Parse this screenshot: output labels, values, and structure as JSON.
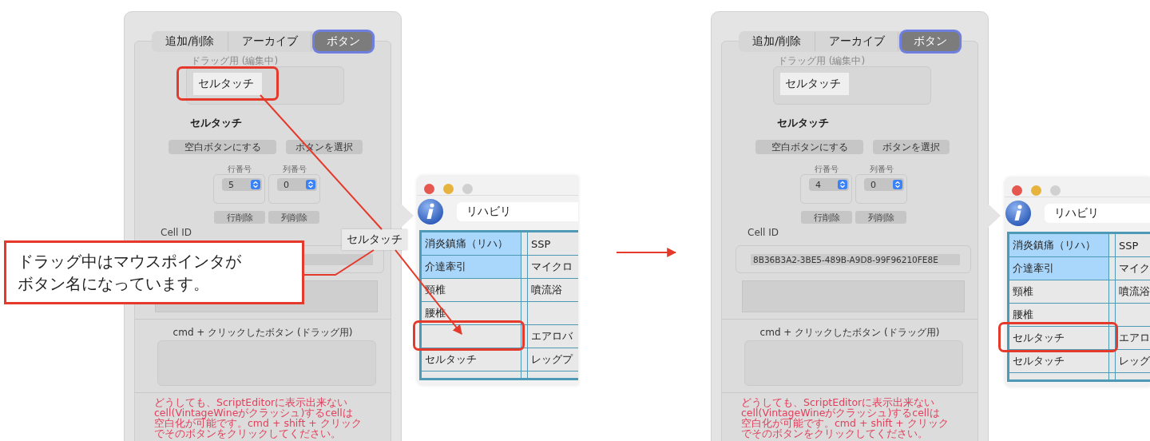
{
  "steps": [
    {
      "panel": {
        "tabs": [
          {
            "label": "追加/削除",
            "selected": false
          },
          {
            "label": "アーカイブ",
            "selected": false
          },
          {
            "label": "ボタン",
            "selected": true
          }
        ],
        "drag_label": "ドラッグ用 (編集中)",
        "drag_chip": {
          "label": "セルタッチ",
          "highlighted": true
        },
        "button_name": "セルタッチ",
        "action_buttons": [
          "空白ボタンにする",
          "ボタンを選択"
        ],
        "row_number": {
          "label": "行番号",
          "value": "5"
        },
        "column_number": {
          "label": "列番号",
          "value": "0"
        },
        "delete_buttons": [
          "行削除",
          "列削除"
        ],
        "cell_id_label": "Cell ID",
        "cmd_click_label": "cmd + クリックしたボタン (ドラッグ用)",
        "note": [
          "どうしても、ScriptEditorに表示出来ない",
          "cell(VintageWineがクラッシュ)するcellは",
          "空白化が可能です。cmd + shift + クリック",
          "でそのボタンをクリックしてください。"
        ]
      },
      "window": {
        "search_value": "リハビリ",
        "rows": [
          {
            "column_1": "消炎鎮痛（リハ）",
            "column_2": "SSP",
            "selected": true,
            "highlighted": false
          },
          {
            "column_1": "介達牽引",
            "column_2": "マイクロ",
            "selected": true,
            "highlighted": false
          },
          {
            "column_1": "頸椎",
            "column_2": "噴流浴",
            "selected": false,
            "highlighted": false
          },
          {
            "column_1": "腰椎",
            "selected": false,
            "highlighted": false
          },
          {
            "column_2": "エアロバ",
            "selected": false,
            "highlighted": true
          },
          {
            "column_1": "セルタッチ",
            "column_2": "レッグプ",
            "selected": false,
            "highlighted": false
          }
        ]
      },
      "drag_tooltip": "セルタッチ",
      "callout": [
        "ドラッグ中はマウスポインタが",
        "ボタン名になっています。"
      ]
    },
    {
      "panel": {
        "tabs": [
          {
            "label": "追加/削除",
            "selected": false
          },
          {
            "label": "アーカイブ",
            "selected": false
          },
          {
            "label": "ボタン",
            "selected": true
          }
        ],
        "drag_label": "ドラッグ用 (編集中)",
        "drag_chip": {
          "label": "セルタッチ",
          "highlighted": false
        },
        "button_name": "セルタッチ",
        "action_buttons": [
          "空白ボタンにする",
          "ボタンを選択"
        ],
        "row_number": {
          "label": "行番号",
          "value": "4"
        },
        "column_number": {
          "label": "列番号",
          "value": "0"
        },
        "delete_buttons": [
          "行削除",
          "列削除"
        ],
        "cell_id_label": "Cell ID",
        "cell_id": "8B36B3A2-3BE5-489B-A9D8-99F96210FE8E",
        "cmd_click_label": "cmd + クリックしたボタン (ドラッグ用)",
        "note": [
          "どうしても、ScriptEditorに表示出来ない",
          "cell(VintageWineがクラッシュ)するcellは",
          "空白化が可能です。cmd + shift + クリック",
          "でそのボタンをクリックしてください。"
        ]
      },
      "window": {
        "search_value": "リハビリ",
        "rows": [
          {
            "column_1": "消炎鎮痛（リハ）",
            "column_2": "SSP",
            "selected": true,
            "highlighted": false
          },
          {
            "column_1": "介達牽引",
            "column_2": "マイク",
            "selected": true,
            "highlighted": false
          },
          {
            "column_1": "頸椎",
            "column_2": "噴流浴",
            "selected": false,
            "highlighted": false
          },
          {
            "column_1": "腰椎",
            "selected": false,
            "highlighted": false
          },
          {
            "column_1": "セルタッチ",
            "column_2": "エアロ",
            "selected": false,
            "highlighted": true
          },
          {
            "column_1": "セルタッチ",
            "column_2": "レッグ",
            "selected": false,
            "highlighted": false
          }
        ]
      }
    }
  ]
}
